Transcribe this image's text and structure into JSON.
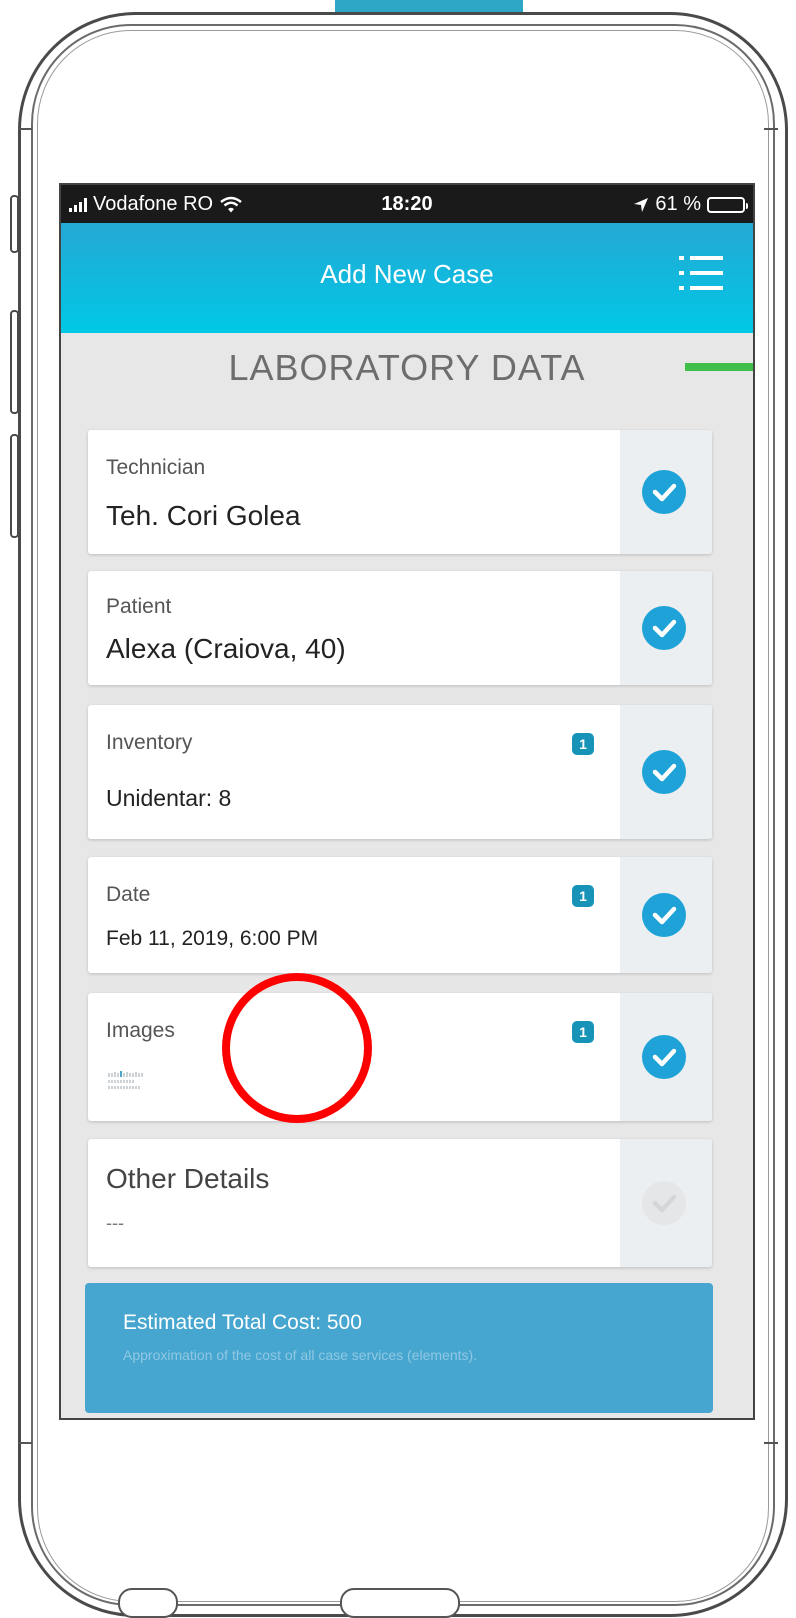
{
  "statusbar": {
    "carrier": "Vodafone RO",
    "time": "18:20",
    "battery": "61 %",
    "battery_level": 0.61,
    "battery_color": "#f2c811"
  },
  "appbar": {
    "title": "Add New Case",
    "menu_icon": "list-menu-icon",
    "colors": {
      "gradient_top": "#25a8d4",
      "gradient_bottom": "#00c8e6",
      "accent": "#3fbf4a"
    }
  },
  "section": {
    "title": "LABORATORY DATA"
  },
  "cards": [
    {
      "id": "technician",
      "label": "Technician",
      "value": "Teh. Cori Golea",
      "checked": true
    },
    {
      "id": "patient",
      "label": "Patient",
      "value": "Alexa (Craiova, 40)",
      "checked": true
    },
    {
      "id": "inventory",
      "label": "Inventory",
      "value": "Unidentar: 8",
      "badge": "1",
      "checked": true
    },
    {
      "id": "date",
      "label": "Date",
      "value": "Feb 11, 2019, 6:00 PM",
      "badge": "1",
      "checked": true
    },
    {
      "id": "images",
      "label": "Images",
      "badge": "1",
      "checked": true,
      "thumbnail_icon": "image-thumbnail-icon"
    },
    {
      "id": "other-details",
      "label": "Other Details",
      "value": "---",
      "checked": false
    }
  ],
  "cost": {
    "title": "Estimated Total Cost: 500",
    "subtitle": "Approximation of the cost of all case services (elements).",
    "color": "#46a6d0"
  },
  "colors": {
    "check_on": "#1ea2d8",
    "check_off": "#e4e6e8",
    "badge": "#1793b8",
    "highlight_circle": "#ff0000"
  }
}
